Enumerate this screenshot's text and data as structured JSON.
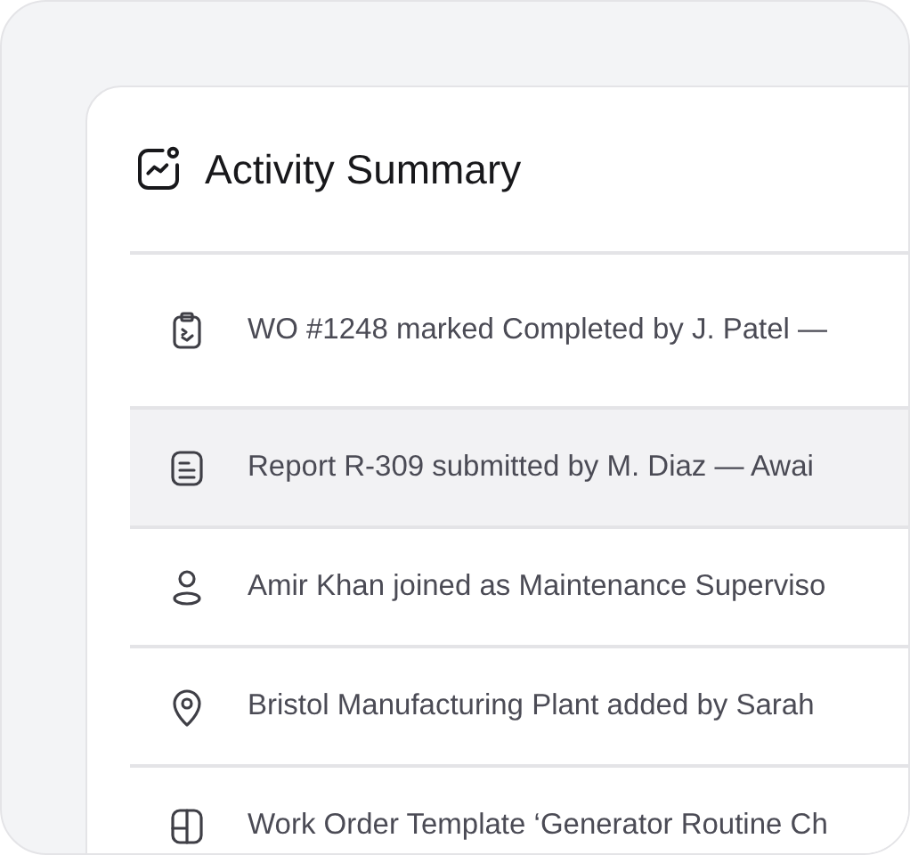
{
  "card": {
    "title": "Activity Summary"
  },
  "activities": [
    {
      "kind": "clipboard",
      "text": "WO #1248 marked Completed by J. Patel —",
      "selected": false
    },
    {
      "kind": "document",
      "text": "Report R-309 submitted by M. Diaz — Awai",
      "selected": true
    },
    {
      "kind": "user",
      "text": "Amir Khan joined as Maintenance Superviso",
      "selected": false
    },
    {
      "kind": "location",
      "text": "Bristol Manufacturing Plant added by Sarah",
      "selected": false
    },
    {
      "kind": "layout",
      "text": "Work Order Template ‘Generator Routine Ch",
      "selected": false
    }
  ]
}
